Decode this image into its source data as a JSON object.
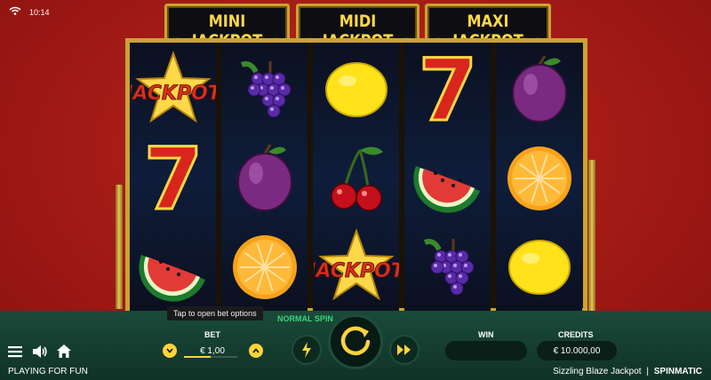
{
  "status": {
    "time": "10:14"
  },
  "jackpots": [
    {
      "label": "MINI JACKPOT"
    },
    {
      "label": "MIDI JACKPOT"
    },
    {
      "label": "MAXI JACKPOT"
    }
  ],
  "reels": [
    [
      "jackpot-star",
      "seven",
      "watermelon"
    ],
    [
      "grapes",
      "plum",
      "orange"
    ],
    [
      "lemon",
      "cherries",
      "jackpot-star"
    ],
    [
      "seven",
      "watermelon",
      "grapes"
    ],
    [
      "plum",
      "orange",
      "lemon"
    ]
  ],
  "symbol_text": {
    "jackpot": "JACKPOT",
    "seven": "7"
  },
  "controls": {
    "tooltip": "Tap to open bet options",
    "spin_mode": "NORMAL SPIN",
    "bet_label": "BET",
    "bet_value": "€ 1,00",
    "win_label": "WIN",
    "win_value": "",
    "credits_label": "CREDITS",
    "credits_value": "€ 10.000,00"
  },
  "footer": {
    "mode": "PLAYING FOR FUN",
    "game_name": "Sizzling Blaze Jackpot",
    "brand": "SPINMATIC"
  },
  "colors": {
    "accent": "#ffd43b",
    "spin_green": "#3ed37a",
    "background_red": "#b0211a",
    "bar_green": "#16402f"
  }
}
